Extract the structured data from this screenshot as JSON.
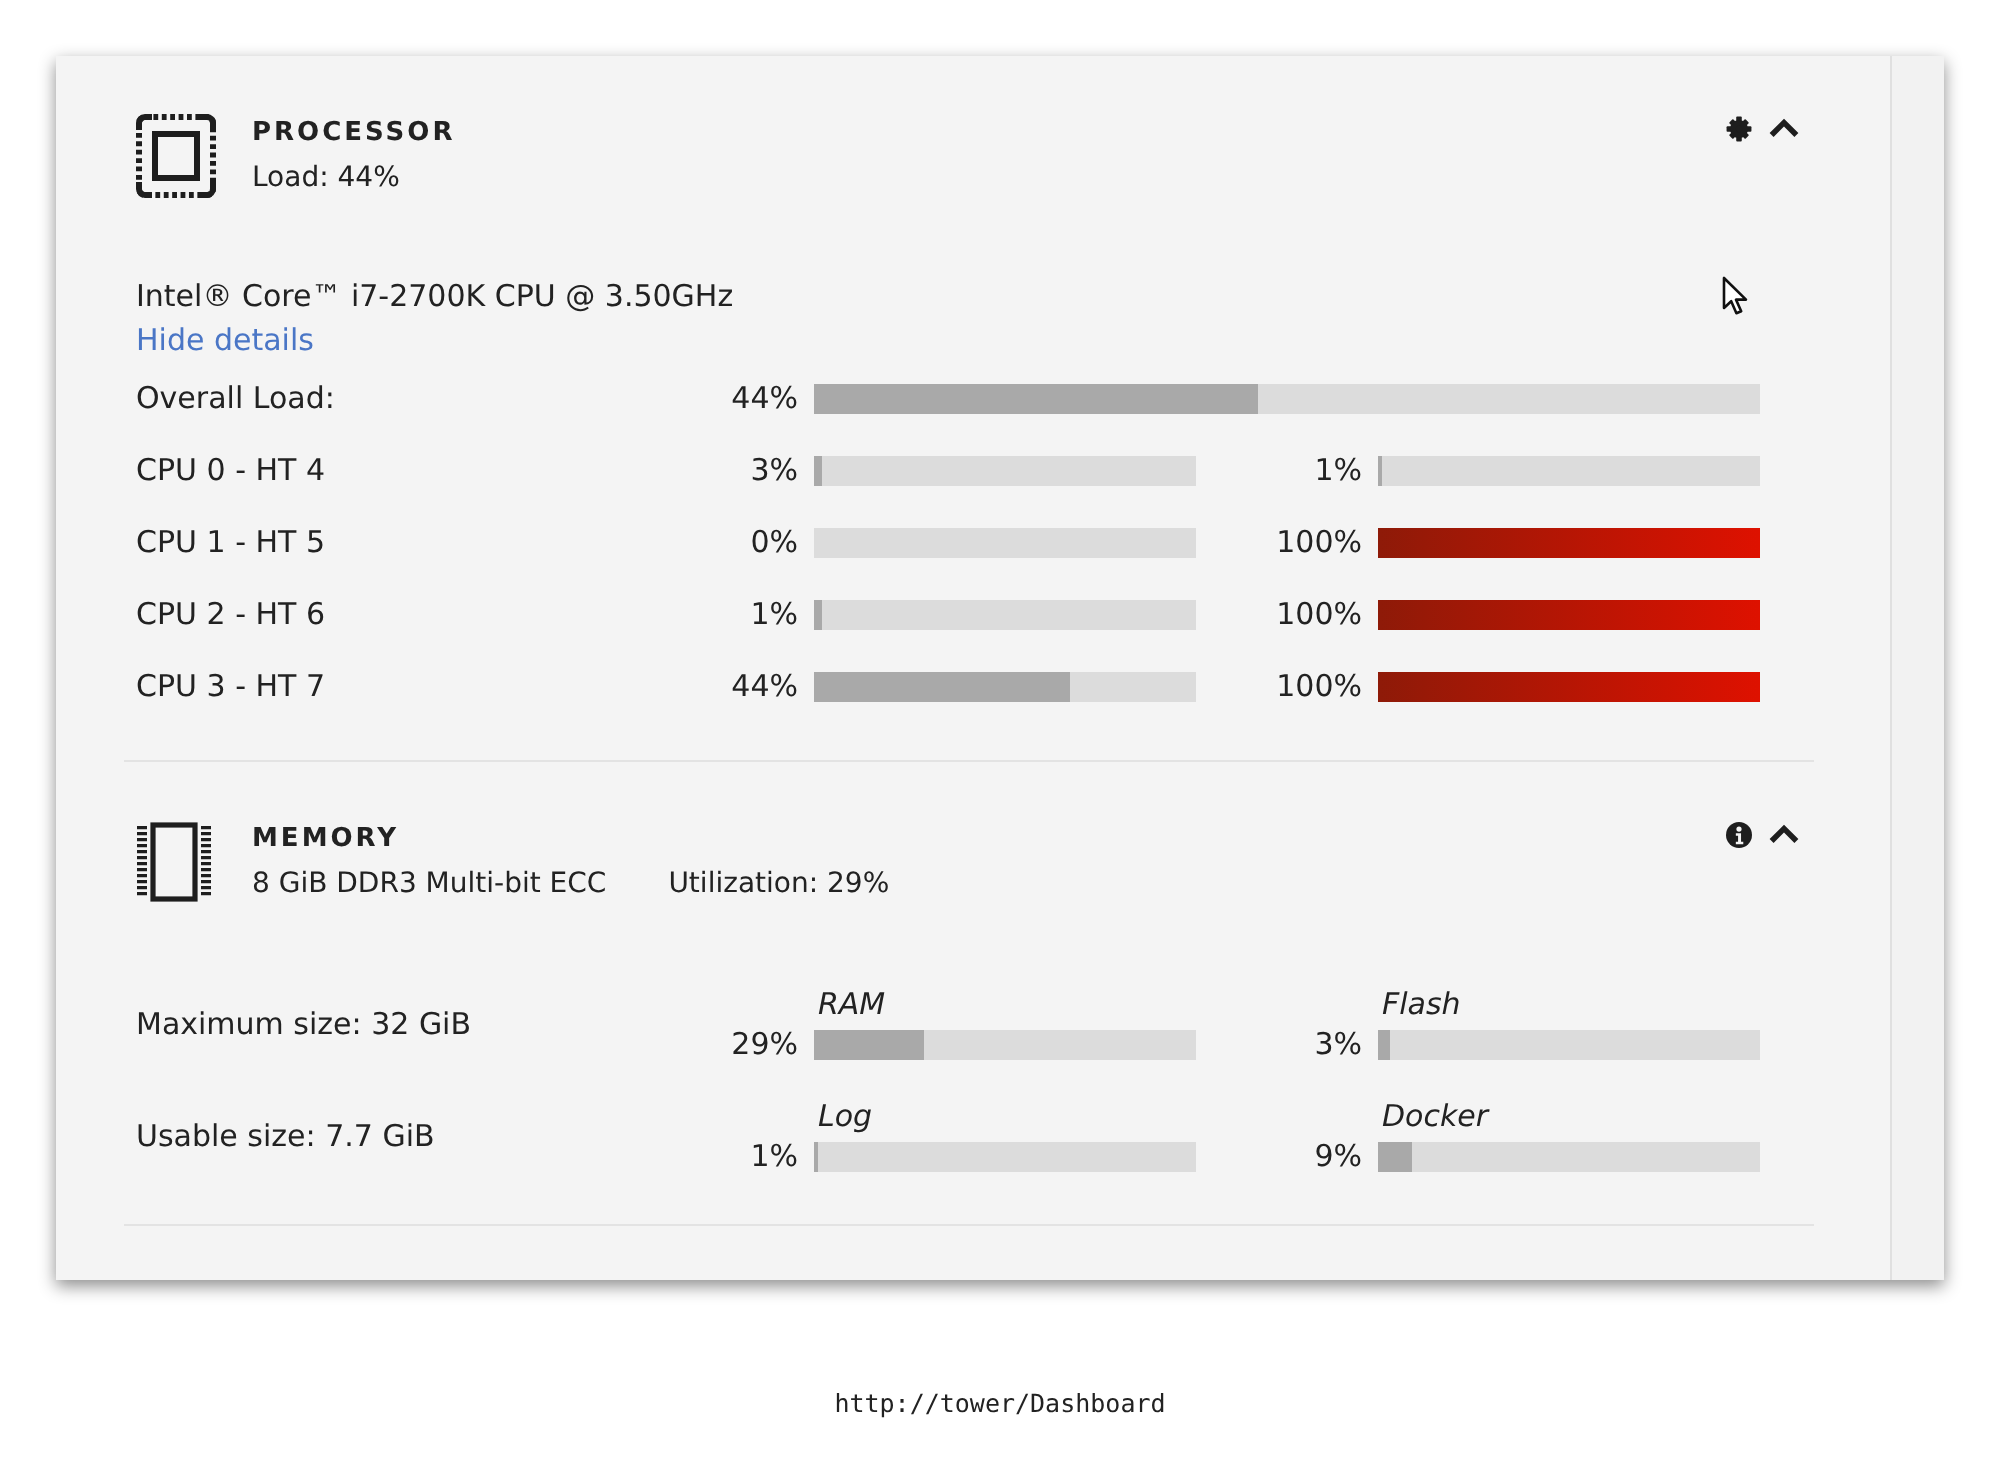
{
  "processor": {
    "title": "PROCESSOR",
    "load": "Load: 44%",
    "expanded": true,
    "model": "Intel® Core™ i7-2700K CPU @ 3.50GHz",
    "details_link": "Hide details",
    "overall": {
      "label": "Overall Load:",
      "reading": "44%",
      "level": 0.47
    },
    "cores": [
      {
        "label": "CPU 0 - HT 4",
        "threads": [
          {
            "reading": "3%",
            "level": 0.02
          },
          {
            "reading": "1%",
            "level": 0.01
          }
        ]
      },
      {
        "label": "CPU 1 - HT 5",
        "threads": [
          {
            "reading": "0%",
            "level": 0
          },
          {
            "reading": "100%",
            "level": 1
          }
        ]
      },
      {
        "label": "CPU 2 - HT 6",
        "threads": [
          {
            "reading": "1%",
            "level": 0.02
          },
          {
            "reading": "100%",
            "level": 1
          }
        ]
      },
      {
        "label": "CPU 3 - HT 7",
        "threads": [
          {
            "reading": "44%",
            "level": 0.67
          },
          {
            "reading": "100%",
            "level": 1
          }
        ]
      }
    ]
  },
  "memory": {
    "title": "MEMORY",
    "spec": "8 GiB DDR3 Multi-bit ECC",
    "utilization": "Utilization: 29%",
    "expanded": true,
    "rows": [
      {
        "label": "Maximum size: 32 GiB",
        "meters": [
          {
            "name": "RAM",
            "reading": "29%",
            "level": 0.29
          },
          {
            "name": "Flash",
            "reading": "3%",
            "level": 0.03
          }
        ]
      },
      {
        "label": "Usable size: 7.7 GiB",
        "meters": [
          {
            "name": "Log",
            "reading": "1%",
            "level": 0.01
          },
          {
            "name": "Docker",
            "reading": "9%",
            "level": 0.09
          }
        ]
      }
    ]
  },
  "url": "http://tower/Dashboard"
}
